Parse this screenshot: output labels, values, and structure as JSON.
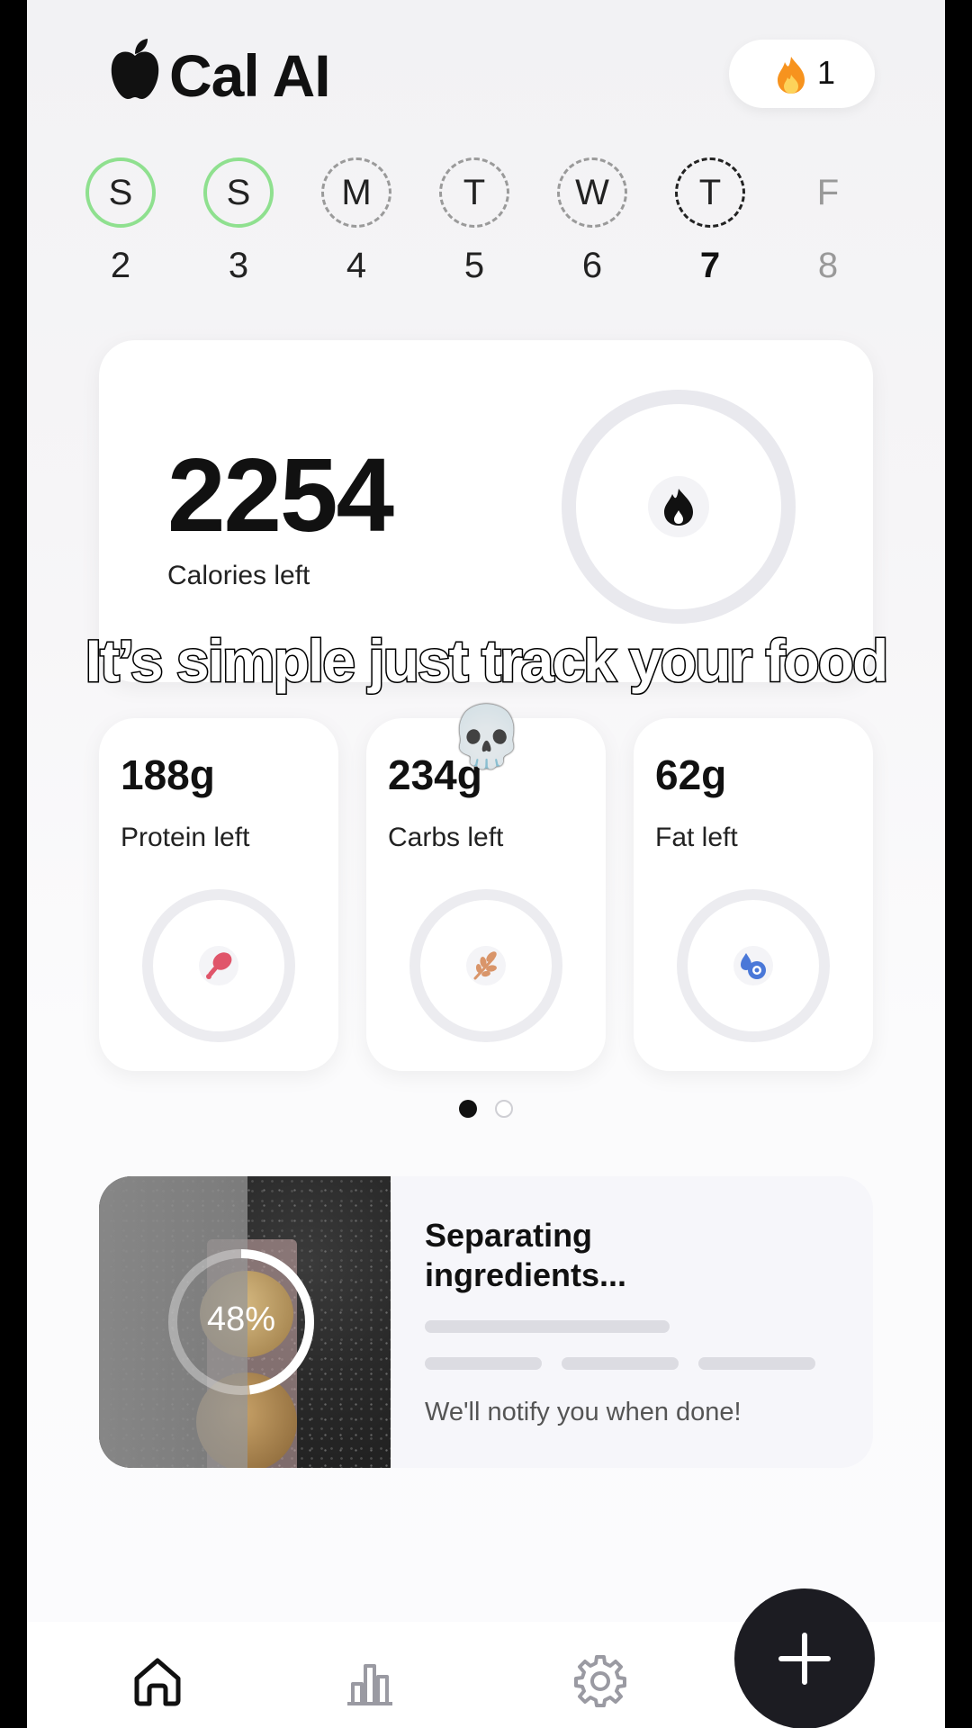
{
  "app": {
    "title": "Cal AI",
    "streak_count": "1"
  },
  "week": [
    {
      "letter": "S",
      "date": "2",
      "state": "done"
    },
    {
      "letter": "S",
      "date": "3",
      "state": "done"
    },
    {
      "letter": "M",
      "date": "4",
      "state": "pending"
    },
    {
      "letter": "T",
      "date": "5",
      "state": "pending"
    },
    {
      "letter": "W",
      "date": "6",
      "state": "pending"
    },
    {
      "letter": "T",
      "date": "7",
      "state": "today"
    },
    {
      "letter": "F",
      "date": "8",
      "state": "future"
    }
  ],
  "calories": {
    "value": "2254",
    "label": "Calories left"
  },
  "macros": [
    {
      "value": "188g",
      "label": "Protein left",
      "icon": "drumstick-icon",
      "color": "#e0556a"
    },
    {
      "value": "234g",
      "label": "Carbs left",
      "icon": "wheat-icon",
      "color": "#d9956a"
    },
    {
      "value": "62g",
      "label": "Fat left",
      "icon": "oil-drop-icon",
      "color": "#4a78d8"
    }
  ],
  "pager": {
    "active_index": 0,
    "total": 2
  },
  "analysis": {
    "progress_percent": "48%",
    "progress_fraction": 0.48,
    "title": "Separating ingredients...",
    "note": "We'll notify you when done!"
  },
  "caption": {
    "text": "It’s simple just track your food",
    "emoji": "💀"
  },
  "nav": {
    "items": [
      "home-icon",
      "analytics-icon",
      "settings-icon"
    ],
    "fab": "plus-icon"
  },
  "colors": {
    "done_ring": "#8fe08f",
    "fab_bg": "#1c1c22",
    "streak_flame": "#f7931e"
  }
}
